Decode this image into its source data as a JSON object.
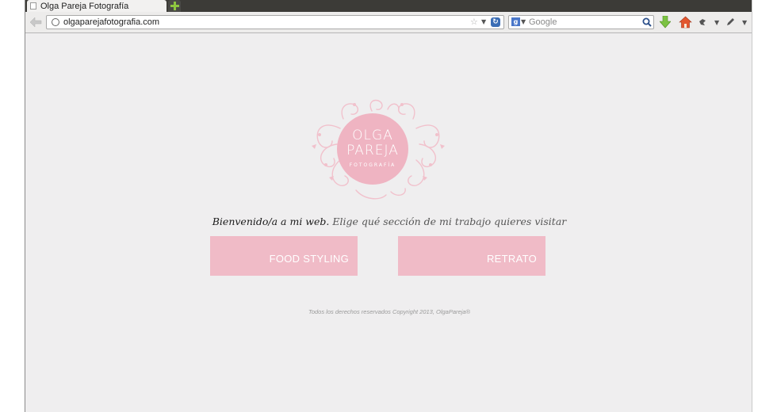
{
  "browser": {
    "tab_title": "Olga Pareja Fotografía",
    "url": "olgaparejafotografia.com",
    "search_placeholder": "Google"
  },
  "logo": {
    "line1": "OLGA",
    "line2": "PAREJA",
    "line3": "FOTOGRAFÍA",
    "color": "#efb4c2"
  },
  "welcome": {
    "strong": "Bienvenido/a a mi web.",
    "light": "Elige qué sección de mi trabajo quieres visitar"
  },
  "sections": {
    "food_styling": "FOOD STYLING",
    "retrato": "RETRATO",
    "button_color": "#f0bbc7"
  },
  "footer": {
    "text": "Todos los derechos reservados Copyright 2013, OlgaPareja®"
  }
}
